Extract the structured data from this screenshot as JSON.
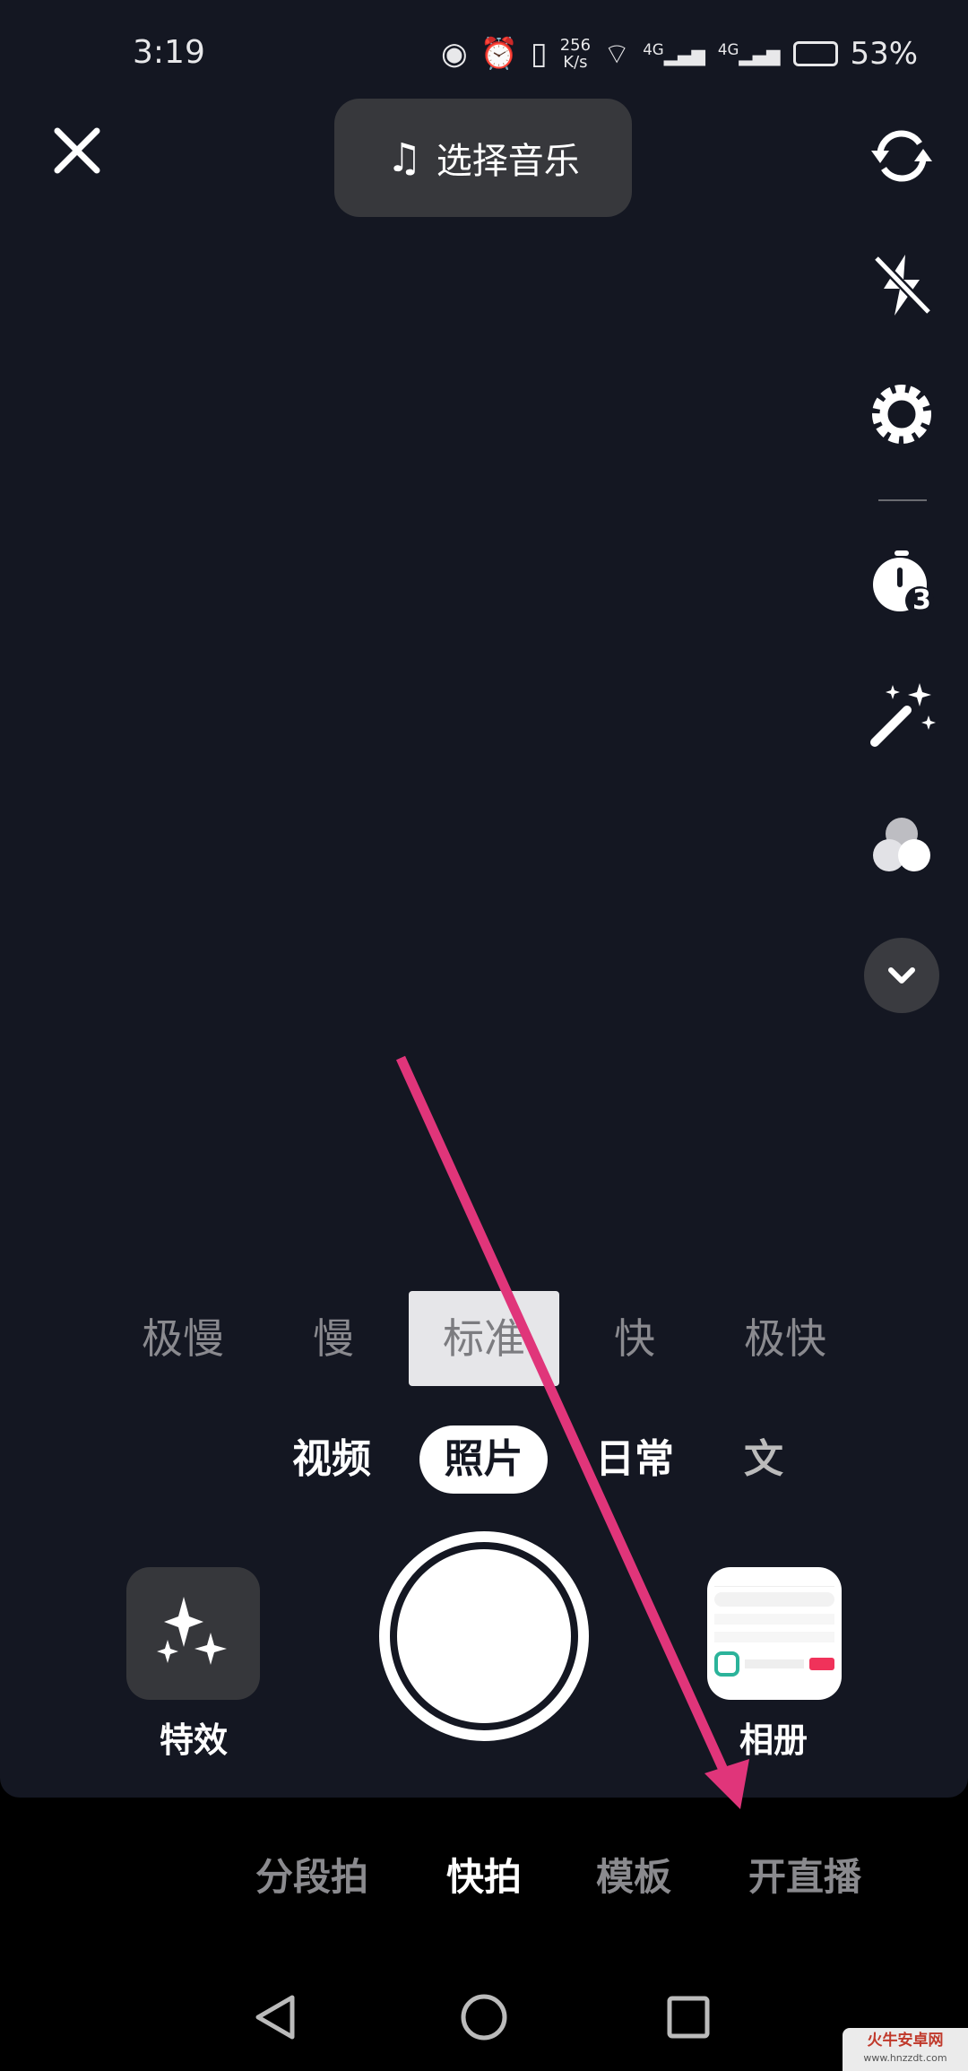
{
  "status_bar": {
    "time": "3:19",
    "net_speed_value": "256",
    "net_speed_unit": "K/s",
    "signal_1": "4G",
    "signal_2": "4G",
    "battery": "53%"
  },
  "top": {
    "music_label": "选择音乐"
  },
  "right_toolbar": {
    "icons": [
      "flip-camera-icon",
      "flash-off-icon",
      "settings-icon",
      "timer-icon",
      "beauty-wand-icon",
      "filter-icon",
      "chevron-down-icon"
    ],
    "timer_value": "3"
  },
  "speed": {
    "options": [
      "极慢",
      "慢",
      "标准",
      "快",
      "极快"
    ],
    "selected": "标准"
  },
  "modes": {
    "items": [
      "视频",
      "照片",
      "日常",
      "文"
    ],
    "selected": "照片"
  },
  "capture": {
    "effects_label": "特效",
    "album_label": "相册"
  },
  "bottom_tabs": {
    "items": [
      "分段拍",
      "快拍",
      "模板",
      "开直播"
    ],
    "selected": "快拍"
  },
  "annotation": {
    "arrow_color": "#e0357a"
  },
  "watermark": {
    "text": "火牛安卓网",
    "url": "www.hnzzdt.com"
  },
  "colors": {
    "camera_bg": "#141722",
    "button_bg": "#37383c"
  }
}
